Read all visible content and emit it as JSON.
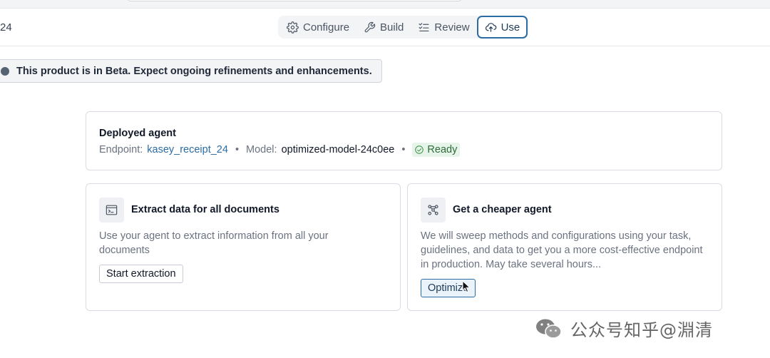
{
  "header": {
    "left_fragment": "24",
    "tabs": [
      {
        "label": "Configure",
        "icon": "gear-icon",
        "active": false
      },
      {
        "label": "Build",
        "icon": "wrench-icon",
        "active": false
      },
      {
        "label": "Review",
        "icon": "checklist-icon",
        "active": false
      },
      {
        "label": "Use",
        "icon": "cloud-upload-icon",
        "active": true
      }
    ]
  },
  "beta_banner": {
    "text": "This product is in Beta. Expect ongoing refinements and enhancements."
  },
  "deployed": {
    "title": "Deployed agent",
    "endpoint_label": "Endpoint:",
    "endpoint_value": "kasey_receipt_24",
    "separator": "•",
    "model_label": "Model:",
    "model_value": "optimized-model-24c0ee",
    "status": "Ready",
    "status_color": "#2f8a3f"
  },
  "cards": {
    "extract": {
      "title": "Extract data for all documents",
      "description": "Use your agent to extract information from all your documents",
      "button": "Start extraction",
      "icon": "terminal-window-icon"
    },
    "cheaper": {
      "title": "Get a cheaper agent",
      "description": "We will sweep methods and configurations using your task, guidelines, and data to get you a more cost-effective endpoint in production. May take several hours...",
      "button": "Optimize",
      "icon": "network-nodes-icon"
    }
  },
  "watermark": {
    "text": "公众号知乎@淵清"
  },
  "colors": {
    "accent": "#2b6ca3",
    "link": "#2b6ca3",
    "ready_bg": "#e7f4ea"
  }
}
